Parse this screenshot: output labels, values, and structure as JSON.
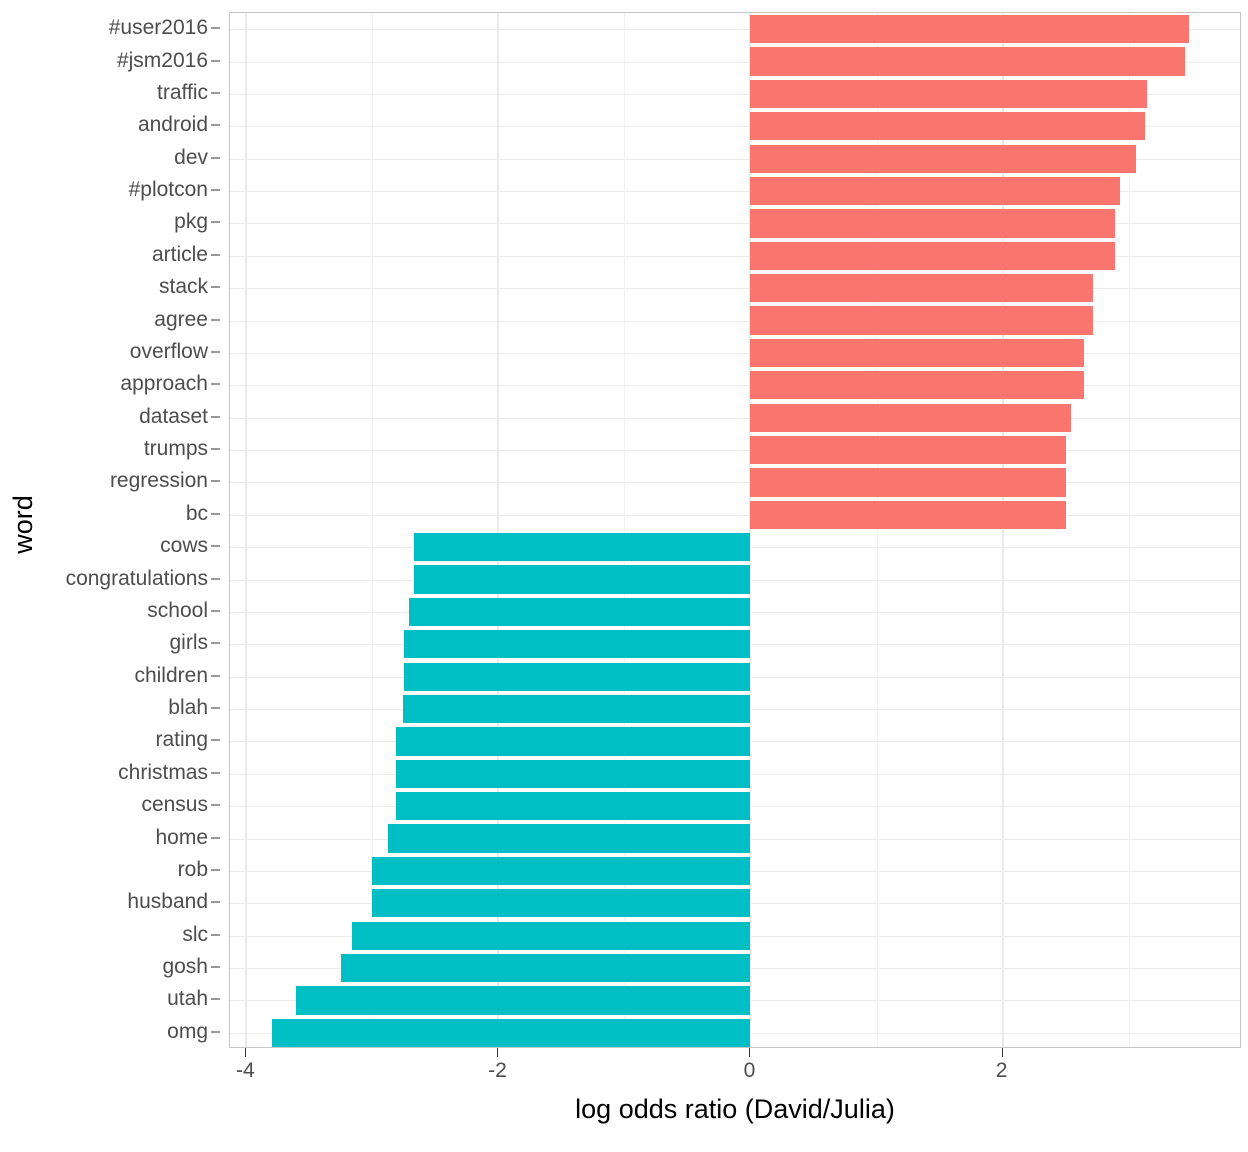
{
  "chart": {
    "type": "bar",
    "orientation": "horizontal",
    "xlabel": "log odds ratio (David/Julia)",
    "ylabel": "word",
    "x_ticks": [
      "-4",
      "-2",
      "0",
      "2"
    ],
    "x_tick_values": [
      -4,
      -2,
      0,
      2
    ],
    "xlim": [
      -4.13,
      3.9
    ],
    "grid": true,
    "legend": "none",
    "colors": {
      "positive": "#F8766D",
      "negative": "#00BFC4",
      "panel_border": "#c6c6c6",
      "grid_major": "#ebebeb",
      "grid_minor": "#f2f2f2",
      "tick_text": "#4d4d4d",
      "axis_title": "#000000",
      "background": "#ffffff"
    }
  },
  "chart_data": {
    "type": "bar",
    "title": "",
    "subtitle": "",
    "xlabel": "log odds ratio (David/Julia)",
    "ylabel": "word",
    "orientation": "horizontal",
    "xlim": [
      -4.13,
      3.9
    ],
    "grid": true,
    "legend_position": "none",
    "categories": [
      "#user2016",
      "#jsm2016",
      "traffic",
      "android",
      "dev",
      "#plotcon",
      "pkg",
      "article",
      "stack",
      "agree",
      "overflow",
      "approach",
      "dataset",
      "trumps",
      "regression",
      "bc",
      "cows",
      "congratulations",
      "school",
      "girls",
      "children",
      "blah",
      "rating",
      "christmas",
      "census",
      "home",
      "rob",
      "husband",
      "slc",
      "gosh",
      "utah",
      "omg"
    ],
    "values": [
      3.48,
      3.45,
      3.15,
      3.13,
      3.06,
      2.93,
      2.89,
      2.89,
      2.72,
      2.72,
      2.65,
      2.65,
      2.54,
      2.5,
      2.5,
      2.5,
      -2.67,
      -2.67,
      -2.71,
      -2.75,
      -2.75,
      -2.76,
      -2.81,
      -2.81,
      -2.81,
      -2.88,
      -3.0,
      -3.0,
      -3.16,
      -3.25,
      -3.61,
      -3.8
    ],
    "series": [
      {
        "name": "log odds ratio (David/Julia)",
        "values": [
          3.48,
          3.45,
          3.15,
          3.13,
          3.06,
          2.93,
          2.89,
          2.89,
          2.72,
          2.72,
          2.65,
          2.65,
          2.54,
          2.5,
          2.5,
          2.5,
          -2.67,
          -2.67,
          -2.71,
          -2.75,
          -2.75,
          -2.76,
          -2.81,
          -2.81,
          -2.81,
          -2.88,
          -3.0,
          -3.0,
          -3.16,
          -3.25,
          -3.61,
          -3.8
        ]
      }
    ],
    "x_tick_labels": [
      "-4",
      "-2",
      "0",
      "2"
    ],
    "x_tick_values": [
      -4,
      -2,
      0,
      2
    ],
    "minor_tick_values": [
      -3,
      -1,
      1,
      3
    ]
  }
}
